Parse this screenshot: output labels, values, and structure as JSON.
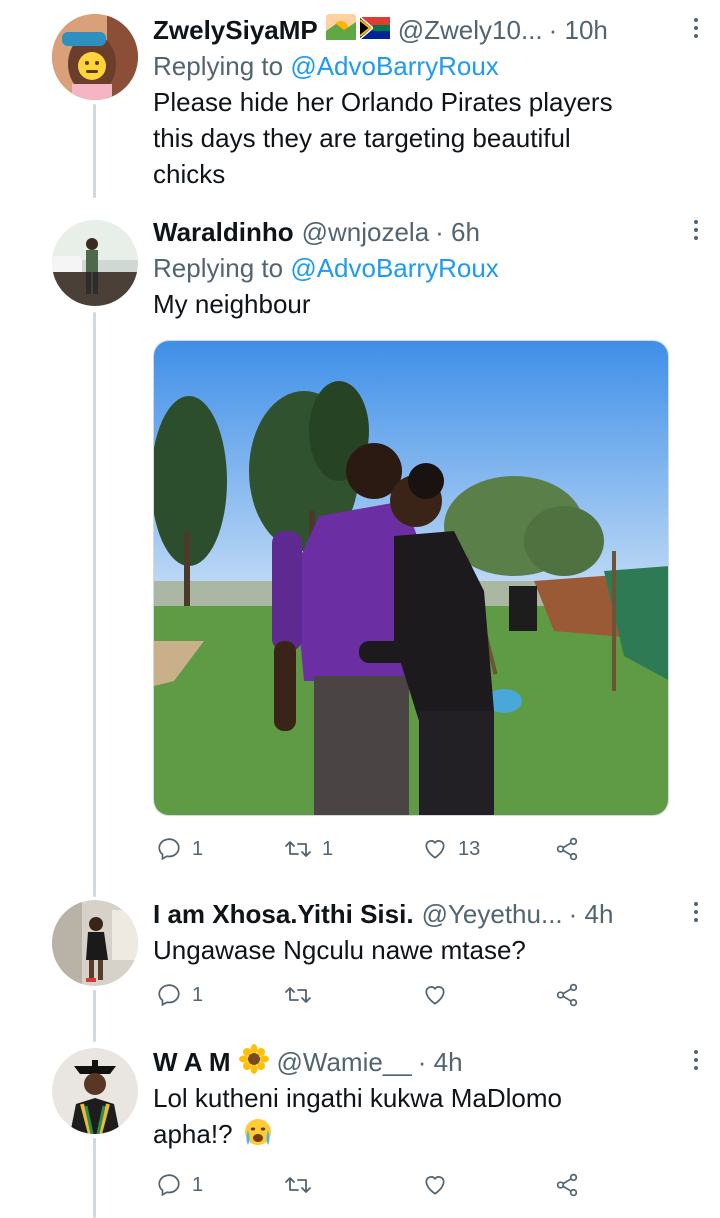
{
  "tweets": [
    {
      "name": "ZwelySiyaMP",
      "handle": "@Zwely10...",
      "time": "· 10h",
      "replying_prefix": "Replying to ",
      "replying_to": "@AdvoBarryRoux",
      "text_lines": [
        "Please hide her Orlando Pirates players",
        "this days they are targeting beautiful",
        "chicks"
      ],
      "emoji_icons": [
        "sunrise-emoji-icon",
        "south-africa-flag-icon"
      ]
    },
    {
      "name": "Waraldinho",
      "handle": "@wnjozela",
      "time": "· 6h",
      "replying_prefix": "Replying to ",
      "replying_to": "@AdvoBarryRoux",
      "text": "My neighbour",
      "actions": {
        "replies": "1",
        "retweets": "1",
        "likes": "13"
      }
    },
    {
      "name": "I am Xhosa.Yithi Sisi.",
      "handle": "@Yeyethu...",
      "time": "· 4h",
      "text": "Ungawase Ngculu nawe mtase?",
      "actions": {
        "replies": "1",
        "retweets": "",
        "likes": ""
      }
    },
    {
      "name": "W A M",
      "handle": "@Wamie__",
      "time": "· 4h",
      "text_lines": [
        "Lol kutheni ingathi kukwa MaDlomo",
        "apha!?"
      ],
      "emoji_icons": [
        "sunflower-emoji-icon",
        "crying-face-emoji-icon"
      ],
      "actions": {
        "replies": "1",
        "retweets": "",
        "likes": ""
      }
    }
  ],
  "colors": {
    "text": "#0f1419",
    "secondary": "#536471",
    "link": "#1d9bf0",
    "thread_line": "#cfd9de",
    "background": "#ffffff"
  }
}
